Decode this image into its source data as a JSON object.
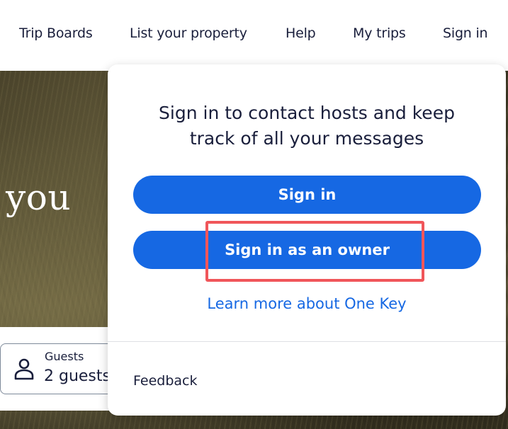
{
  "nav": {
    "items": [
      {
        "label": "Trip Boards"
      },
      {
        "label": "List your property"
      },
      {
        "label": "Help"
      },
      {
        "label": "My trips"
      },
      {
        "label": "Sign in"
      }
    ]
  },
  "hero": {
    "text": "you"
  },
  "search": {
    "guests": {
      "label": "Guests",
      "value": "2 guests",
      "icon": "person-icon"
    }
  },
  "popover": {
    "title_line1": "Sign in to contact hosts and keep",
    "title_line2": "track of all your messages",
    "sign_in_label": "Sign in",
    "owner_sign_in_label": "Sign in as an owner",
    "learn_more_label": "Learn more about One Key",
    "feedback_label": "Feedback"
  },
  "colors": {
    "primary": "#1668e3",
    "highlight": "#f0565a",
    "text": "#191e3b"
  }
}
